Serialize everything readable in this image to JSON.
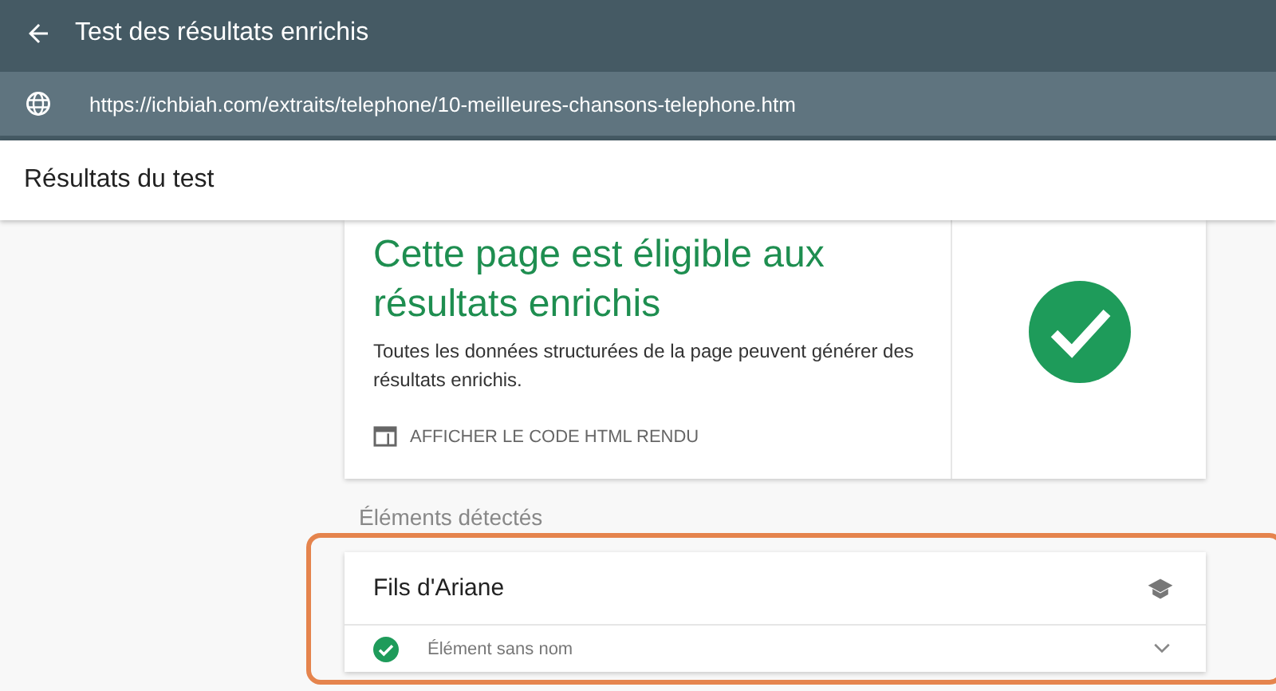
{
  "window": {
    "title": "Test des résultats enrichis"
  },
  "url": "https://ichbiah.com/extraits/telephone/10-meilleures-chansons-telephone.htm",
  "section_title": "Résultats du test",
  "result": {
    "heading": "Cette page est éligible aux résultats enrichis",
    "description": "Toutes les données structurées de la page peuvent générer des résultats enrichis.",
    "action": "AFFICHER LE CODE HTML RENDU"
  },
  "detected": {
    "label": "Éléments détectés",
    "card": {
      "title": "Fils d'Ariane",
      "items": [
        {
          "label": "Élément sans nom",
          "expanded": false
        }
      ]
    }
  }
}
